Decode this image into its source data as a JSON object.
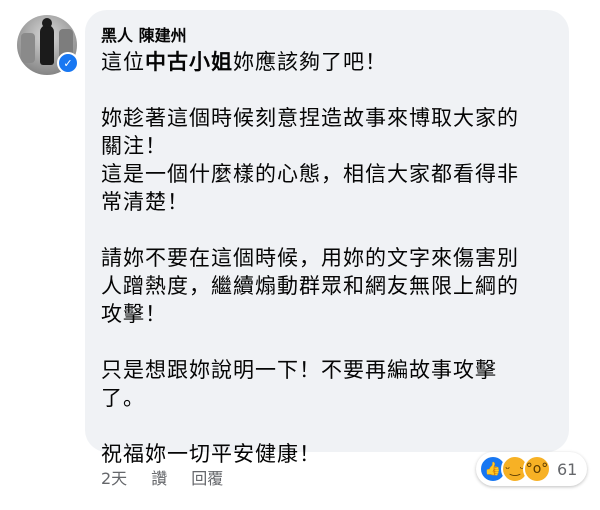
{
  "comment": {
    "author": "黑人 陳建州",
    "paragraphs": [
      {
        "parts": [
          "這位",
          "中古小姐",
          "妳應該夠了吧！"
        ]
      },
      {
        "text": "妳趁著這個時候刻意捏造故事來博取大家的\n關注！\n這是一個什麼樣的心態，相信大家都看得非\n常清楚！"
      },
      {
        "text": "請妳不要在這個時候，用妳的文字來傷害別\n人蹭熱度，繼續煽動群眾和網友無限上綱的\n攻擊！"
      },
      {
        "text": "只是想跟妳說明一下！不要再編故事攻擊\n了。"
      },
      {
        "text": "祝福妳一切平安健康！"
      }
    ]
  },
  "actions": {
    "timestamp": "2天",
    "like_label": "讚",
    "reply_label": "回覆"
  },
  "reactions": {
    "types": [
      "like-icon",
      "haha-icon",
      "wow-icon"
    ],
    "count": "61"
  },
  "colors": {
    "bubble_bg": "#f0f2f5",
    "link_text": "#65676b",
    "verified": "#1877f2",
    "like": "#1877f2",
    "emoji": "#f7b125"
  }
}
